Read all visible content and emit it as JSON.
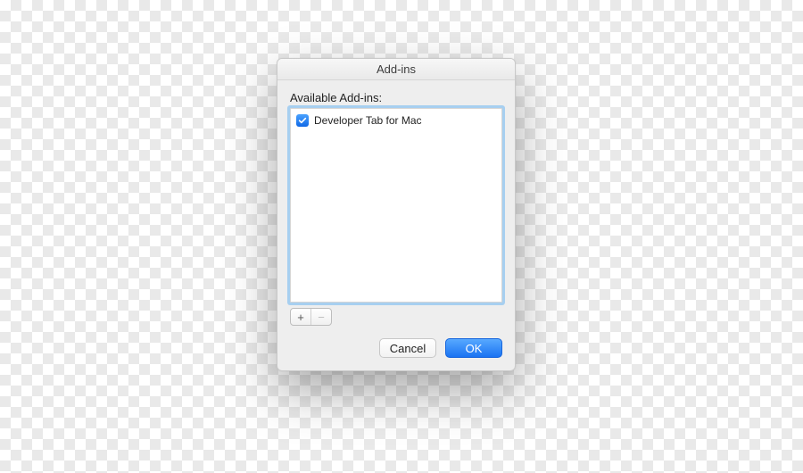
{
  "window": {
    "title": "Add-ins"
  },
  "section": {
    "label": "Available Add-ins:"
  },
  "list": {
    "items": [
      {
        "label": "Developer Tab for Mac",
        "checked": true
      }
    ]
  },
  "controls": {
    "plus": "+",
    "minus": "−"
  },
  "buttons": {
    "cancel": "Cancel",
    "ok": "OK"
  }
}
